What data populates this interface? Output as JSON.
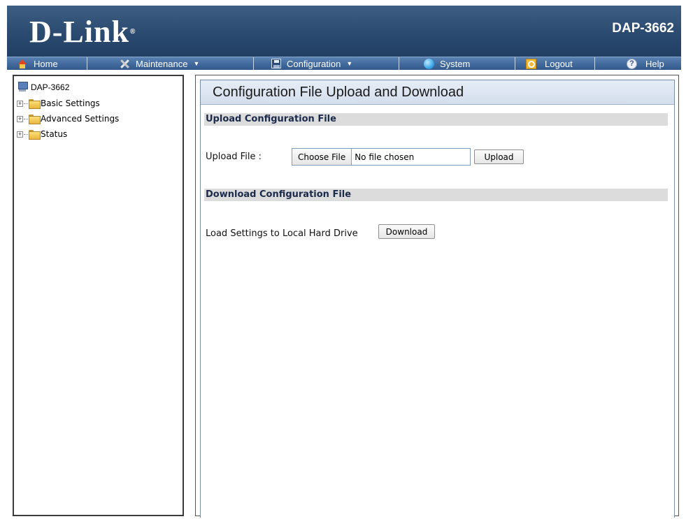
{
  "header": {
    "logo_text": "D-Link",
    "logo_reg": "®",
    "model": "DAP-3662"
  },
  "menu": {
    "home": "Home",
    "maintenance": "Maintenance",
    "configuration": "Configuration",
    "system": "System",
    "logout": "Logout",
    "help": "Help",
    "caret": "▼"
  },
  "sidebar": {
    "root": "DAP-3662",
    "items": [
      {
        "label": "Basic Settings"
      },
      {
        "label": "Advanced Settings"
      },
      {
        "label": "Status"
      }
    ]
  },
  "main": {
    "title": "Configuration File Upload and Download",
    "upload_section": "Upload Configuration File",
    "upload_label": "Upload File :",
    "choose_file": "Choose File",
    "no_file": "No file chosen",
    "upload_button": "Upload",
    "download_section": "Download Configuration File",
    "download_label": "Load Settings to Local Hard Drive",
    "download_button": "Download"
  },
  "colors": {
    "header": "#2b4a70",
    "menubar": "#3f679a",
    "section_bg": "#dcdcdc"
  }
}
